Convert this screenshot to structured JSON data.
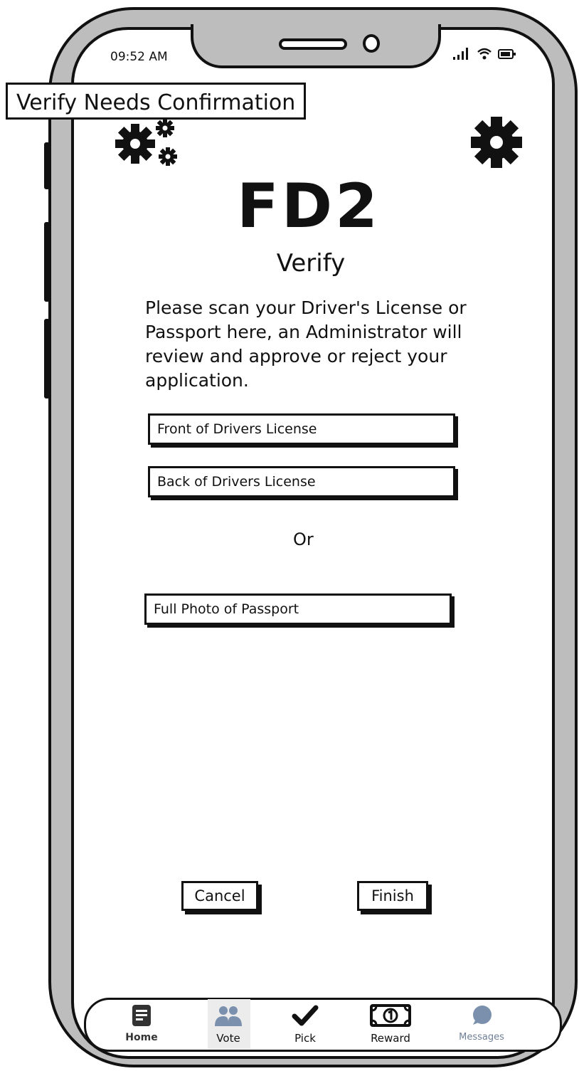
{
  "status_bar": {
    "time": "09:52 AM"
  },
  "banner": {
    "text": "Verify Needs Confirmation"
  },
  "header": {
    "left_icon": "gears-icon",
    "right_icon": "gear-icon",
    "brand": "FD2",
    "title": "Verify"
  },
  "instructions": "Please scan your Driver's License or Passport here, an Administrator will review and approve or reject your application.",
  "fields": {
    "front_license": "Front of Drivers License",
    "back_license": "Back of Drivers License",
    "or_text": "Or",
    "passport": "Full Photo of Passport"
  },
  "buttons": {
    "cancel": "Cancel",
    "finish": "Finish"
  },
  "nav": [
    {
      "label": "Home",
      "icon": "document-icon"
    },
    {
      "label": "Vote",
      "icon": "people-icon"
    },
    {
      "label": "Pick",
      "icon": "checkmark-icon"
    },
    {
      "label": "Reward",
      "icon": "dollar-bill-icon"
    },
    {
      "label": "Messages",
      "icon": "chat-bubble-icon"
    }
  ]
}
